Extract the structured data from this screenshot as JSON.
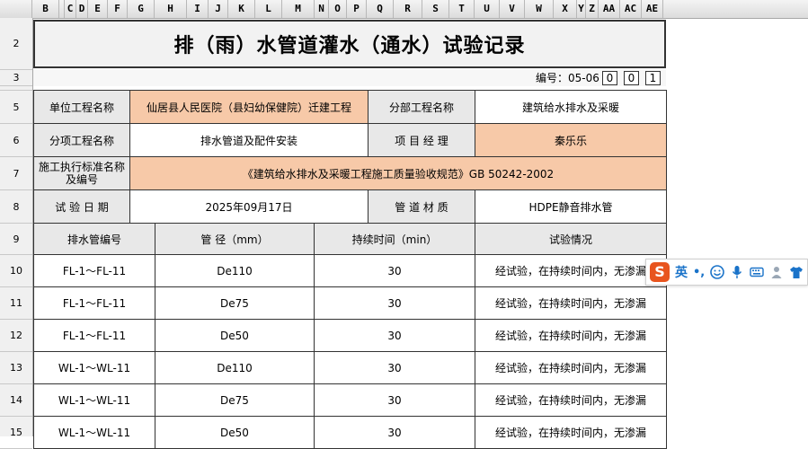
{
  "columns": [
    "B",
    "C",
    "D",
    "E",
    "F",
    "G",
    "H",
    "I",
    "J",
    "K",
    "L",
    "M",
    "N",
    "O",
    "P",
    "Q",
    "R",
    "S",
    "T",
    "U",
    "V",
    "W",
    "X",
    "Y",
    "Z",
    "AA",
    "AC",
    "AE"
  ],
  "rows": [
    "2",
    "3",
    "5",
    "6",
    "7",
    "8",
    "9",
    "10",
    "11",
    "12",
    "13",
    "14",
    "15"
  ],
  "title": "排（雨）水管道灌水（通水）试验记录",
  "doc_number": {
    "label": "编号：05-06",
    "digits": [
      "0",
      "0",
      "1"
    ]
  },
  "info": {
    "unit_project_label": "单位工程名称",
    "unit_project_value": "仙居县人民医院（县妇幼保健院）迁建工程",
    "sub_project_label": "分部工程名称",
    "sub_project_value": "建筑给水排水及采暖",
    "item_project_label": "分项工程名称",
    "item_project_value": "排水管道及配件安装",
    "manager_label": "项 目 经 理",
    "manager_value": "秦乐乐",
    "standard_label": "施工执行标准名称及编号",
    "standard_value": "《建筑给水排水及采暖工程施工质量验收规范》GB 50242-2002",
    "date_label": "试 验 日 期",
    "date_value": "2025年09月17日",
    "material_label": "管  道  材  质",
    "material_value": "HDPE静音排水管"
  },
  "table": {
    "headers": [
      "排水管编号",
      "管    径（mm）",
      "持续时间（min）",
      "试验情况"
    ],
    "rows": [
      [
        "FL-1～FL-11",
        "De110",
        "30",
        "经试验，在持续时间内，无渗漏"
      ],
      [
        "FL-1～FL-11",
        "De75",
        "30",
        "经试验，在持续时间内，无渗漏"
      ],
      [
        "FL-1～FL-11",
        "De50",
        "30",
        "经试验，在持续时间内，无渗漏"
      ],
      [
        "WL-1～WL-11",
        "De110",
        "30",
        "经试验，在持续时间内，无渗漏"
      ],
      [
        "WL-1～WL-11",
        "De75",
        "30",
        "经试验，在持续时间内，无渗漏"
      ],
      [
        "WL-1～WL-11",
        "De50",
        "30",
        "经试验，在持续时间内，无渗漏"
      ]
    ]
  },
  "ime": {
    "logo": "S",
    "mode": "英",
    "punct": "•,"
  },
  "colors": {
    "peach": "#f7c9a8",
    "label_gray": "#e8e8e8",
    "ime_orange": "#e8541e",
    "ime_blue": "#1a73c9"
  }
}
